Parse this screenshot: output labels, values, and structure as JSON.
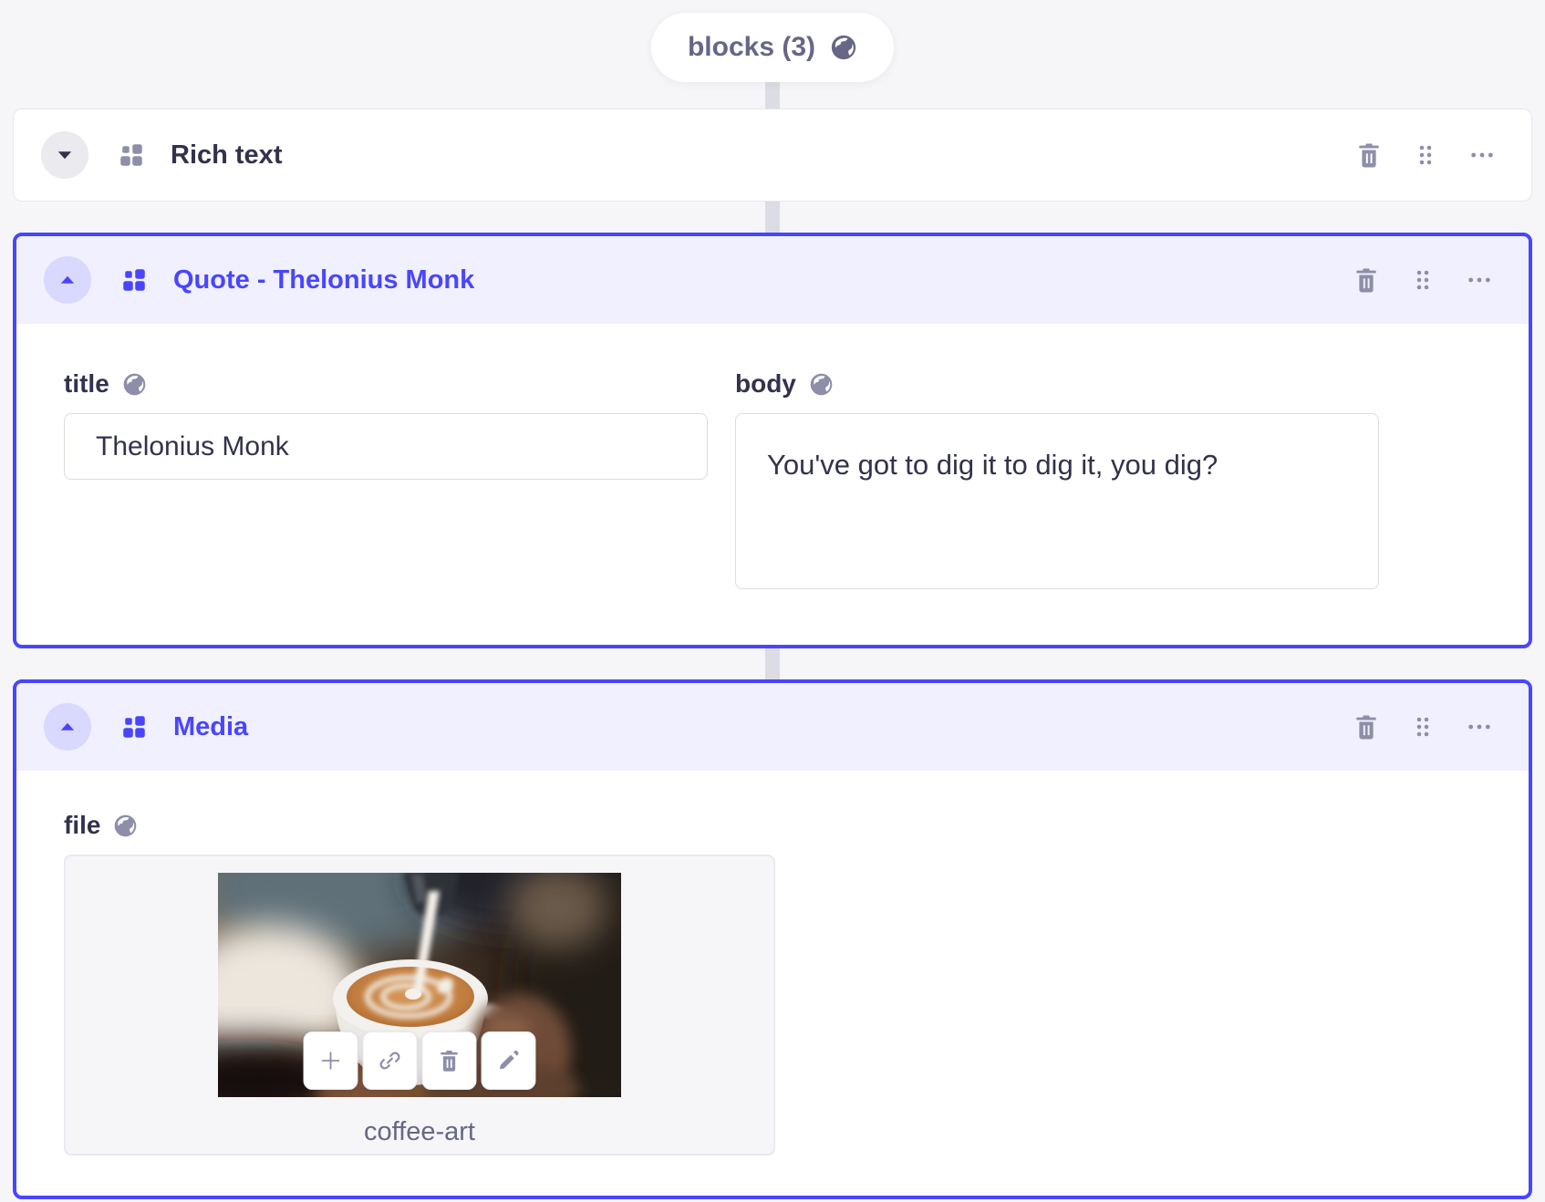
{
  "zone": {
    "field_chip": {
      "label": "blocks (3)",
      "icon": "globe-localized"
    }
  },
  "header_actions": {
    "delete": "delete-block",
    "drag": "drag-to-reorder",
    "more": "more-options"
  },
  "blocks": [
    {
      "id": "rich-text",
      "label": "Rich text",
      "state": "collapsed"
    },
    {
      "id": "quote",
      "label": "Quote - Thelonius Monk",
      "state": "expanded",
      "fields": {
        "title": {
          "label": "title",
          "localized": true,
          "value": "Thelonius Monk"
        },
        "body": {
          "label": "body",
          "localized": true,
          "value": "You've got to dig it to dig it, you dig?"
        }
      }
    },
    {
      "id": "media",
      "label": "Media",
      "state": "expanded",
      "fields": {
        "file": {
          "label": "file",
          "localized": true,
          "filename": "coffee-art",
          "actions": [
            "add-media",
            "copy-link",
            "delete-media",
            "edit-media"
          ]
        }
      }
    }
  ],
  "icons": {
    "globe": "localized-field-globe",
    "grid": "block-type-grid",
    "caret-down": "collapsed-caret",
    "caret-up": "expanded-caret",
    "trash": "delete",
    "dots6": "drag-handle",
    "ellipsis": "more-options",
    "plus": "add",
    "link": "copy-link",
    "pencil": "edit"
  },
  "colors": {
    "primary": "#4945ff",
    "primary_bg": "#f0f0ff",
    "page_bg": "#f6f6f9",
    "text": "#32324d",
    "text_muted": "#666687",
    "icon_muted": "#8e8ea9",
    "input_border": "#dcdce4",
    "connector": "#dcdce4"
  }
}
